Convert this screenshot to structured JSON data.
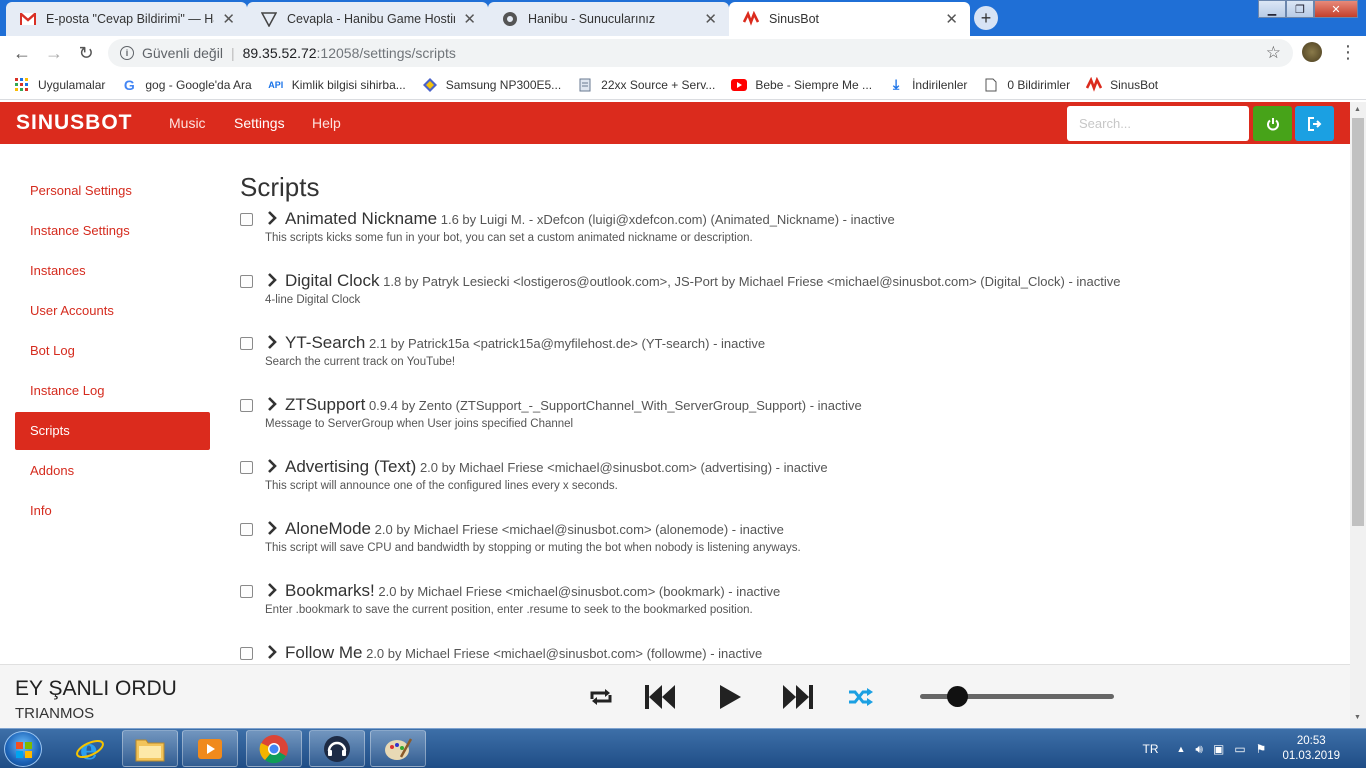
{
  "browser": {
    "tabs": [
      {
        "title": "E-posta \"Cevap Bildirimi\" — Hanibu",
        "icon": "gmail-icon",
        "active": false
      },
      {
        "title": "Cevapla - Hanibu Game Hosting",
        "icon": "hanibu-triangle-icon",
        "active": false
      },
      {
        "title": "Hanibu - Sunucularınız",
        "icon": "hanibu-logo-icon",
        "active": false
      },
      {
        "title": "SinusBot",
        "icon": "sinusbot-icon",
        "active": true
      }
    ],
    "address": {
      "security": "Güvenli değil",
      "host": "89.35.52.72",
      "path": ":12058/settings/scripts"
    },
    "bookmarks": [
      {
        "label": "Uygulamalar",
        "icon": "apps-grid-icon"
      },
      {
        "label": "gog - Google'da Ara",
        "icon": "google-icon"
      },
      {
        "label": "Kimlik bilgisi sihirba...",
        "icon": "api-icon"
      },
      {
        "label": "Samsung NP300E5...",
        "icon": "samsung-icon"
      },
      {
        "label": "22xx Source + Serv...",
        "icon": "file-icon"
      },
      {
        "label": "Bebe - Siempre Me ...",
        "icon": "youtube-icon"
      },
      {
        "label": "İndirilenler",
        "icon": "download-icon"
      },
      {
        "label": "0 Bildirimler",
        "icon": "document-icon"
      },
      {
        "label": "SinusBot",
        "icon": "sinusbot-icon"
      }
    ]
  },
  "app": {
    "logo": "SINUSBOT",
    "nav": {
      "music": "Music",
      "settings": "Settings",
      "help": "Help"
    },
    "search_placeholder": "Search...",
    "brand_color": "#db2b1d"
  },
  "sidebar": {
    "items": [
      {
        "label": "Personal Settings",
        "active": false
      },
      {
        "label": "Instance Settings",
        "active": false
      },
      {
        "label": "Instances",
        "active": false
      },
      {
        "label": "User Accounts",
        "active": false
      },
      {
        "label": "Bot Log",
        "active": false
      },
      {
        "label": "Instance Log",
        "active": false
      },
      {
        "label": "Scripts",
        "active": true
      },
      {
        "label": "Addons",
        "active": false
      },
      {
        "label": "Info",
        "active": false
      }
    ]
  },
  "page": {
    "title": "Scripts",
    "scripts": [
      {
        "name": "Animated Nickname",
        "meta": "1.6 by Luigi M. - xDefcon (luigi@xdefcon.com) (Animated_Nickname) - inactive",
        "desc": "This scripts kicks some fun in your bot, you can set a custom animated nickname or description."
      },
      {
        "name": "Digital Clock",
        "meta": "1.8 by Patryk Lesiecki <lostigeros@outlook.com>, JS-Port by Michael Friese <michael@sinusbot.com> (Digital_Clock) - inactive",
        "desc": "4-line Digital Clock"
      },
      {
        "name": "YT-Search",
        "meta": "2.1 by Patrick15a <patrick15a@myfilehost.de> (YT-search) - inactive",
        "desc": "Search the current track on YouTube!"
      },
      {
        "name": "ZTSupport",
        "meta": "0.9.4 by Zento (ZTSupport_-_SupportChannel_With_ServerGroup_Support) - inactive",
        "desc": "Message to ServerGroup when User joins specified Channel"
      },
      {
        "name": "Advertising (Text)",
        "meta": "2.0 by Michael Friese <michael@sinusbot.com> (advertising) - inactive",
        "desc": "This script will announce one of the configured lines every x seconds."
      },
      {
        "name": "AloneMode",
        "meta": "2.0 by Michael Friese <michael@sinusbot.com> (alonemode) - inactive",
        "desc": "This script will save CPU and bandwidth by stopping or muting the bot when nobody is listening anyways."
      },
      {
        "name": "Bookmarks!",
        "meta": "2.0 by Michael Friese <michael@sinusbot.com> (bookmark) - inactive",
        "desc": "Enter .bookmark to save the current position, enter .resume to seek to the bookmarked position."
      },
      {
        "name": "Follow Me",
        "meta": "2.0 by Michael Friese <michael@sinusbot.com> (followme) - inactive",
        "desc": ""
      }
    ]
  },
  "player": {
    "title": "EY ŞANLI ORDU",
    "artist": "TRIANMOS",
    "volume": 0.14,
    "shuffle_color": "#1ba0e2"
  },
  "taskbar": {
    "language": "TR",
    "time": "20:53",
    "date": "01.03.2019"
  }
}
